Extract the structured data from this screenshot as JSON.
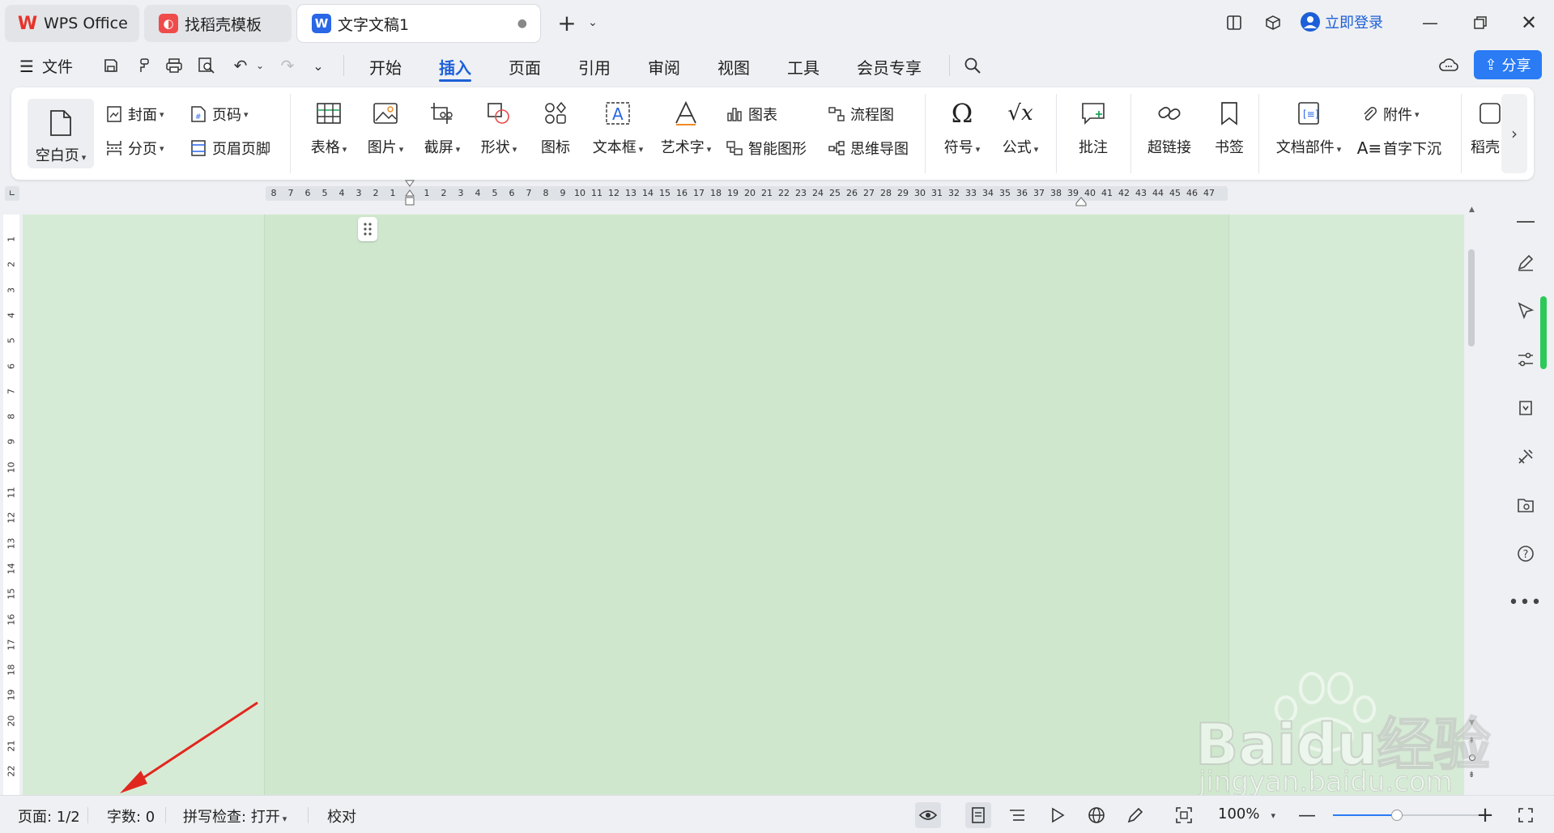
{
  "tabs": [
    {
      "label": "WPS Office",
      "icon": "wps-logo-icon"
    },
    {
      "label": "找稻壳模板",
      "icon": "docer-icon"
    },
    {
      "label": "文字文稿1",
      "icon": "writer-icon",
      "active": true
    }
  ],
  "window": {
    "login_label": "立即登录"
  },
  "menu": {
    "file_label": "文件",
    "items": [
      "开始",
      "插入",
      "页面",
      "引用",
      "审阅",
      "视图",
      "工具",
      "会员专享"
    ],
    "active": "插入",
    "share_label": "分享"
  },
  "ribbon": {
    "blank_page": "空白页",
    "cover": "封面",
    "page_break": "分页",
    "page_number": "页码",
    "header_footer": "页眉页脚",
    "table": "表格",
    "picture": "图片",
    "screenshot": "截屏",
    "shape": "形状",
    "icon": "图标",
    "textbox": "文本框",
    "wordart": "艺术字",
    "chart": "图表",
    "smartart": "智能图形",
    "flowchart": "流程图",
    "mindmap": "思维导图",
    "symbol": "符号",
    "formula": "公式",
    "comment": "批注",
    "hyperlink": "超链接",
    "bookmark": "书签",
    "doc_parts": "文档部件",
    "attachment": "附件",
    "drop_cap": "首字下沉",
    "docer_partial": "稻壳"
  },
  "ruler": {
    "left": [
      "8",
      "7",
      "6",
      "5",
      "4",
      "3",
      "2",
      "1"
    ],
    "right": [
      "1",
      "2",
      "3",
      "4",
      "5",
      "6",
      "7",
      "8",
      "9",
      "10",
      "11",
      "12",
      "13",
      "14",
      "15",
      "16",
      "17",
      "18",
      "19",
      "20",
      "21",
      "22",
      "23",
      "24",
      "25",
      "26",
      "27",
      "28",
      "29",
      "30",
      "31",
      "32",
      "33",
      "34",
      "35",
      "36",
      "37",
      "38",
      "39",
      "40",
      "41",
      "42",
      "43",
      "44",
      "45",
      "46",
      "47"
    ],
    "vertical": [
      "1",
      "2",
      "3",
      "4",
      "5",
      "6",
      "7",
      "8",
      "9",
      "10",
      "11",
      "12",
      "13",
      "14",
      "15",
      "16",
      "17",
      "18",
      "19",
      "20",
      "21",
      "22"
    ]
  },
  "status": {
    "page": "页面: 1/2",
    "words": "字数: 0",
    "spellcheck": "拼写检查: 打开",
    "proofread": "校对",
    "zoom": "100%"
  },
  "watermark": {
    "text": "Baidu经验",
    "url": "jingyan.baidu.com"
  },
  "colors": {
    "accent": "#1d5fd8",
    "page_bg": "#cfe8cd",
    "area_bg": "#d6ebd6",
    "wps_red": "#e8332a",
    "arrow": "#e0281f"
  }
}
